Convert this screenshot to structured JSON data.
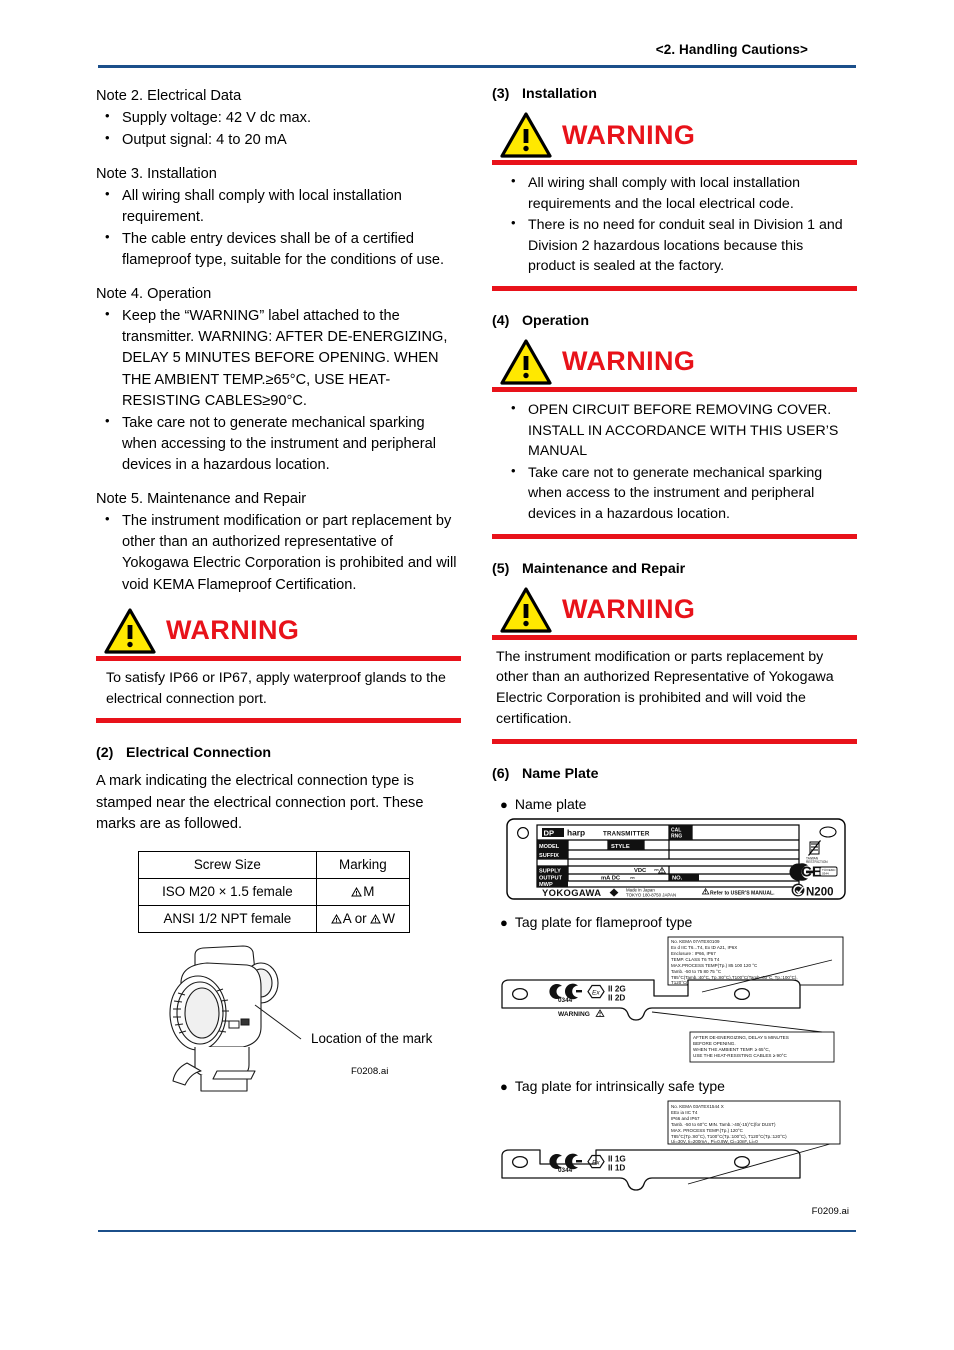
{
  "header": {
    "title": "<2.  Handling Cautions>"
  },
  "left": {
    "note2": {
      "title": "Note 2.  Electrical Data",
      "bullets": [
        "Supply voltage: 42 V dc max.",
        "Output signal: 4 to 20 mA"
      ]
    },
    "note3": {
      "title": "Note 3.  Installation",
      "bullets": [
        "All wiring shall comply with local installation requirement.",
        "The cable entry devices shall be of a certified flameproof type, suitable for the conditions of use."
      ]
    },
    "note4": {
      "title": "Note 4.  Operation",
      "bullets": [
        "Keep the “WARNING” label attached to the transmitter. WARNING: AFTER DE-ENERGIZING, DELAY 5 MINUTES BEFORE OPENING. WHEN THE AMBIENT TEMP.≥65°C, USE HEAT-RESISTING CABLES≥90°C.",
        "Take care not to generate mechanical sparking when accessing to the instrument and peripheral devices in a hazardous location."
      ]
    },
    "note5": {
      "title": "Note 5.  Maintenance and Repair",
      "bullets": [
        "The instrument modification or part replacement by other than an authorized representative of Yokogawa Electric Corporation is prohibited and will void KEMA Flameproof Certification."
      ]
    },
    "warning1": {
      "word": "WARNING",
      "body": "To satisfy IP66 or IP67, apply waterproof glands to the electrical connection port."
    },
    "section2": {
      "num": "(2)",
      "title": "Electrical Connection",
      "para": "A mark indicating the electrical connection type is stamped near the electrical connection port. These marks are as followed."
    },
    "table": {
      "headers": [
        "Screw Size",
        "Marking"
      ],
      "rows": [
        {
          "size": "ISO M20 × 1.5 female",
          "mark": "M",
          "mark_alt": ""
        },
        {
          "size": "ANSI 1/2 NPT female",
          "mark": "A",
          "mark_alt": "W",
          "joiner": "or"
        }
      ]
    },
    "figure": {
      "callout": "Location of the mark",
      "id": "F0208.ai"
    }
  },
  "right": {
    "section3": {
      "num": "(3)",
      "title": "Installation"
    },
    "warning3": {
      "word": "WARNING",
      "bullets": [
        "All wiring shall comply with local installation requirements and the local electrical code.",
        "There is no need for conduit seal in Division 1 and Division 2 hazardous locations because this product is sealed at the factory."
      ]
    },
    "section4": {
      "num": "(4)",
      "title": "Operation"
    },
    "warning4": {
      "word": "WARNING",
      "bullets": [
        "OPEN CIRCUIT BEFORE REMOVING COVER. INSTALL IN ACCORDANCE WITH THIS USER’S MANUAL",
        "Take care not to generate mechanical sparking when access to the instrument and peripheral devices in a hazardous location."
      ]
    },
    "section5": {
      "num": "(5)",
      "title": "Maintenance and Repair"
    },
    "warning5": {
      "word": "WARNING",
      "body": "The instrument modification or parts replacement by other than an authorized Representative of Yokogawa Electric Corporation is prohibited and will void the certification."
    },
    "section6": {
      "num": "(6)",
      "title": "Name Plate"
    },
    "captions": {
      "name_plate": "Name plate",
      "tag_flameproof": "Tag plate for flameproof type",
      "tag_intrinsic": "Tag plate for intrinsically safe type"
    },
    "figure_id": "F0209.ai",
    "nameplate": {
      "brand": "DPharp",
      "product": "TRANSMITTER",
      "cal_rng": "CAL RNG",
      "fields": [
        "MODEL",
        "SUFFIX",
        "SUPPLY",
        "OUTPUT",
        "MWP"
      ],
      "style": "STYLE",
      "supply_unit": "VDC",
      "output_unit": "mA DC",
      "no_label": "NO.",
      "maker": "YOKOGAWA",
      "made_in": "Made in Japan",
      "address": "TOKYO 180-8750 JAPAN",
      "refer": "Refer to USER’S MANUAL.",
      "ce": "CE",
      "ctick": "N200"
    },
    "flameproof_plate": {
      "cert_lines": [
        "No. KEMA 07ATEX0109",
        "Ex d IIC T6...T4,  Ex tD A21, IP6X",
        "Enclosure : IP66, IP67",
        "TEMP. CLASS                         T6       T5       T4",
        "MAX.PROCESS TEMP(Tp.)      85     100     120  °C",
        "Tamb.                           -50   to   75      80      75  °C",
        "T85°C(Tamb.:40°C, Tp.:80°C),T100°C(Tamb.:60°C, Tp.:100°C),",
        "T120°C(Tamb.:80°C, Tp.:120°C)   Min.Tamb.:-40(-15)°C(for Dust)"
      ],
      "ce_number": "0344",
      "ex_mark": "Ex",
      "group_lines": [
        "II 2G",
        "II 2D"
      ],
      "warning_label": "WARNING",
      "warning_lines": [
        "AFTER DE-ENERGIZING, DELAY 5 MINUTES",
        "BEFORE OPENING.",
        "WHEN THE AMBIENT TEMP. ≥ 65°C,",
        "USE THE HEAT-RESISTING CABLES ≥ 90°C"
      ]
    },
    "intrinsic_plate": {
      "cert_lines": [
        "No. KEMA 03ATEX1544 X",
        "EEx ia IIC T4",
        "IP66 and IP67",
        "Tamb.   -50 to 60°C    MIN. Tamb.:-40(-15)°C(for DUST)",
        "MAX. PROCESS TEMP.(Tp.)      120°C",
        "T85°C(Tp.:80°C), T100°C(Tp.:100°C), T120°C(Tp.:120°C)",
        "Ui=30V,  Ii=200mA ,  Pi=0.9W,   Ci=10nF,   Li=0"
      ],
      "ce_number": "0344",
      "ex_mark": "Ex",
      "group_lines": [
        "II 1G",
        "II 1D"
      ]
    }
  },
  "colors": {
    "rule_blue": "#1b4f8a",
    "warning_red": "#e8121a",
    "warning_yellow": "#ffe800"
  }
}
